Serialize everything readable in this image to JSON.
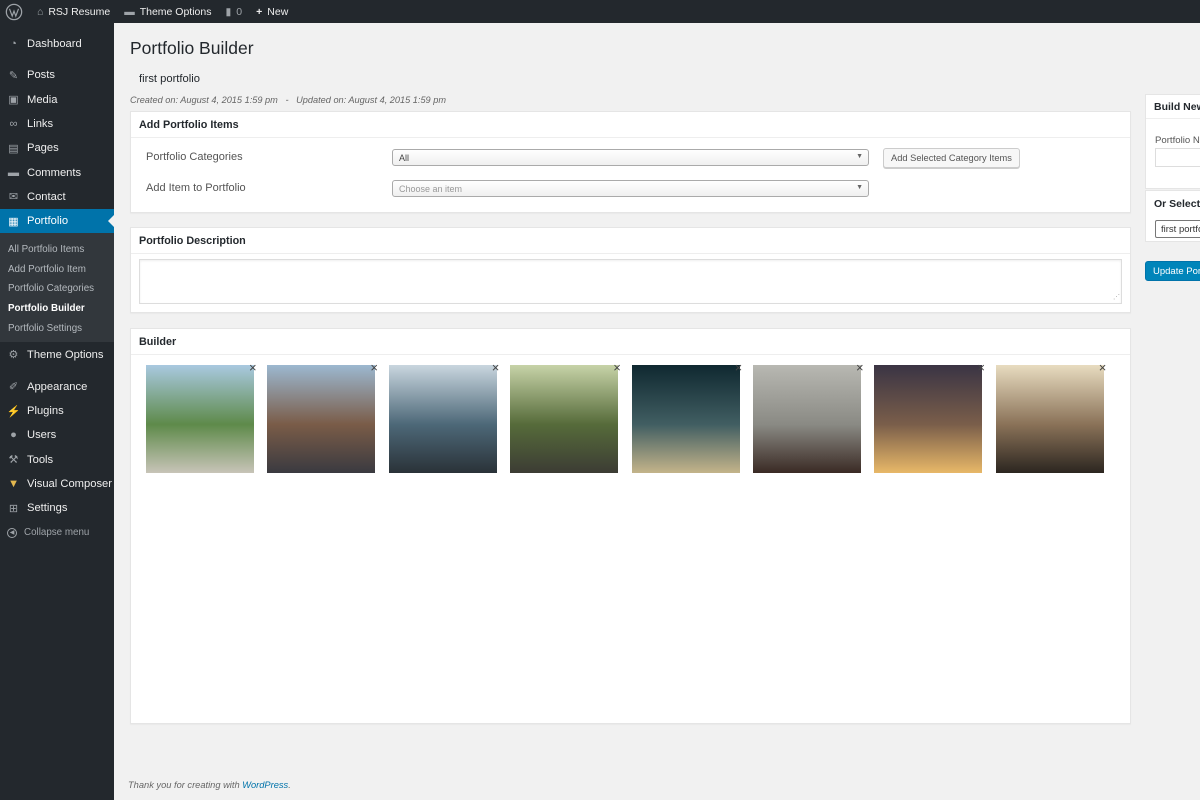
{
  "adminbar": {
    "site_name": "RSJ Resume",
    "theme_options": "Theme Options",
    "comments_count": "0",
    "new_label": "New"
  },
  "sidebar": {
    "items": [
      {
        "label": "Dashboard",
        "icon": "dashboard-icon"
      },
      {
        "label": "Posts",
        "icon": "pin-icon"
      },
      {
        "label": "Media",
        "icon": "media-icon"
      },
      {
        "label": "Links",
        "icon": "link-icon"
      },
      {
        "label": "Pages",
        "icon": "page-icon"
      },
      {
        "label": "Comments",
        "icon": "comment-icon"
      },
      {
        "label": "Contact",
        "icon": "envelope-icon"
      },
      {
        "label": "Portfolio",
        "icon": "portfolio-icon"
      }
    ],
    "portfolio_submenu": [
      "All Portfolio Items",
      "Add Portfolio Item",
      "Portfolio Categories",
      "Portfolio Builder",
      "Portfolio Settings"
    ],
    "items_after": [
      {
        "label": "Theme Options",
        "icon": "gear-icon"
      },
      {
        "label": "Appearance",
        "icon": "brush-icon"
      },
      {
        "label": "Plugins",
        "icon": "plug-icon"
      },
      {
        "label": "Users",
        "icon": "user-icon"
      },
      {
        "label": "Tools",
        "icon": "wrench-icon"
      },
      {
        "label": "Visual Composer",
        "icon": "vc-icon"
      },
      {
        "label": "Settings",
        "icon": "settings-icon"
      }
    ],
    "collapse_label": "Collapse menu"
  },
  "page": {
    "title": "Portfolio Builder",
    "portfolio_name": "first portfolio",
    "meta": "Created on: August 4, 2015 1:59 pm   -   Updated on: August 4, 2015 1:59 pm"
  },
  "add_items": {
    "title": "Add Portfolio Items",
    "categories_label": "Portfolio Categories",
    "categories_value": "All",
    "add_item_label": "Add Item to Portfolio",
    "add_item_placeholder": "Choose an item",
    "add_category_button": "Add Selected Category Items"
  },
  "description": {
    "title": "Portfolio Description",
    "value": ""
  },
  "builder": {
    "title": "Builder",
    "thumbnails": [
      {
        "subject": "man sitting on wall by river",
        "colors": [
          "#a9c9e0",
          "#5e8a4a",
          "#c8c4b8"
        ]
      },
      {
        "subject": "city street between tall buildings",
        "colors": [
          "#9cb8d0",
          "#7a5c48",
          "#3a3a40"
        ]
      },
      {
        "subject": "ocean waves crashing on rocks",
        "colors": [
          "#c9d6df",
          "#4d6878",
          "#2a3238"
        ]
      },
      {
        "subject": "road through rocky tunnel",
        "colors": [
          "#c7d3a8",
          "#566b3a",
          "#3c3c34"
        ]
      },
      {
        "subject": "cathedral dome at night by river",
        "colors": [
          "#0f2830",
          "#415e62",
          "#c4b48a"
        ]
      },
      {
        "subject": "man walking across crosswalk",
        "colors": [
          "#b8b8b2",
          "#8a8a84",
          "#3a2a24"
        ]
      },
      {
        "subject": "foggy night road with lights",
        "colors": [
          "#3a3444",
          "#7a5e4a",
          "#e8b868"
        ]
      },
      {
        "subject": "bicycles parked on european street",
        "colors": [
          "#e8dcc0",
          "#8a7258",
          "#2c2620"
        ]
      }
    ]
  },
  "right_panel": {
    "build_new_title": "Build New Portfolio",
    "portfolio_name_label": "Portfolio Name",
    "select_title": "Or Select a Portfolio",
    "select_value": "first portfolio",
    "update_button": "Update Portfolio"
  },
  "footer": {
    "text": "Thank you for creating with ",
    "link": "WordPress",
    "end": "."
  },
  "colors": {
    "adminbar_bg": "#23282d",
    "accent": "#0073aa",
    "primary_button": "#0085ba",
    "page_bg": "#f1f1f1"
  }
}
